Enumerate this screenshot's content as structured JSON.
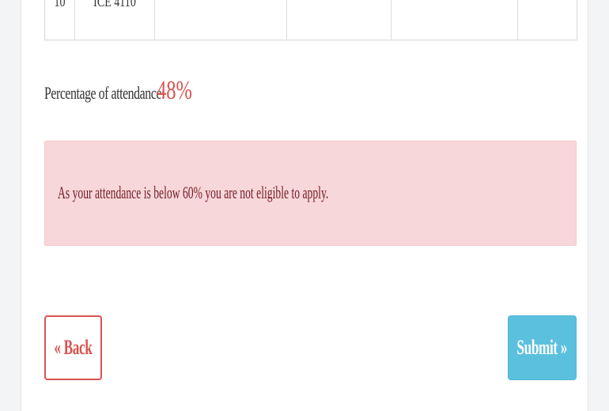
{
  "table": {
    "row": [
      "10",
      "ICE 4110",
      "",
      "",
      "",
      ""
    ]
  },
  "attendance": {
    "label": "Percentage of attendance:",
    "value": "48%"
  },
  "alert": {
    "message": "As your attendance is below 60% you are not eligible to apply."
  },
  "buttons": {
    "back": {
      "icon": "«",
      "label": "Back"
    },
    "submit": {
      "label": "Submit",
      "icon": "»"
    }
  },
  "colors": {
    "danger": "#d9534f",
    "alert_bg": "#f8d7da",
    "alert_text": "#721c24",
    "info": "#5bc0de"
  }
}
